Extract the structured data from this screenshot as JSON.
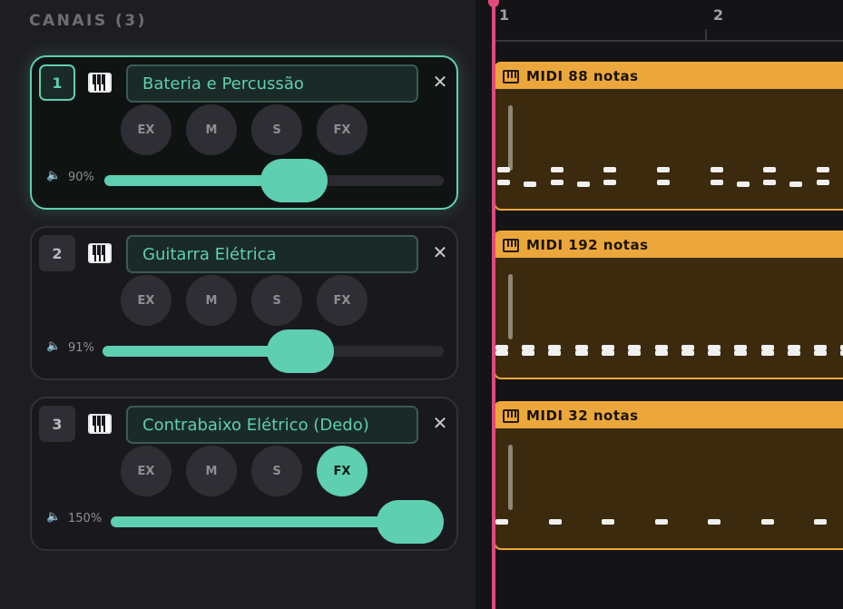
{
  "panel": {
    "title": "CANAIS (3)"
  },
  "channels": [
    {
      "number": "1",
      "name": "Bateria e Percussão",
      "volume_label": "90%",
      "volume_level": 0.56,
      "buttons": {
        "ex": "EX",
        "m": "M",
        "s": "S",
        "fx": "FX"
      },
      "fx_active": false,
      "selected": true
    },
    {
      "number": "2",
      "name": "Guitarra Elétrica",
      "volume_label": "91%",
      "volume_level": 0.58,
      "buttons": {
        "ex": "EX",
        "m": "M",
        "s": "S",
        "fx": "FX"
      },
      "fx_active": false,
      "selected": false
    },
    {
      "number": "3",
      "name": "Contrabaixo Elétrico (Dedo)",
      "volume_label": "150%",
      "volume_level": 1.0,
      "buttons": {
        "ex": "EX",
        "m": "M",
        "s": "S",
        "fx": "FX"
      },
      "fx_active": true,
      "selected": false
    }
  ],
  "icons": {
    "close": "close-icon",
    "piano": "piano-icon",
    "volume": "speaker-icon",
    "clip": "midi-piano-icon"
  },
  "glyphs": {
    "close": "✕",
    "volume": "🔈"
  },
  "timeline": {
    "markers": [
      "1",
      "2"
    ],
    "clips": [
      {
        "title": "MIDI 88 notas"
      },
      {
        "title": "MIDI 192 notas"
      },
      {
        "title": "MIDI 32 notas"
      }
    ]
  },
  "colors": {
    "accent": "#5ecfb1",
    "clip": "#eca73c",
    "playhead": "#e24a7e"
  }
}
